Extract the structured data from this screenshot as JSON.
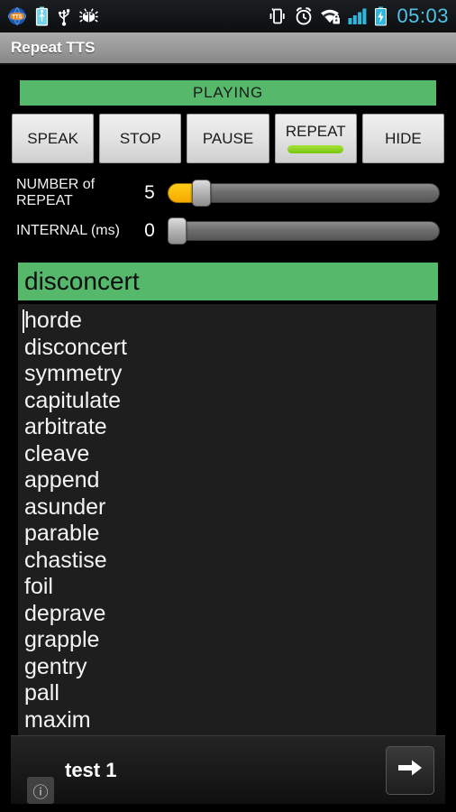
{
  "statusbar": {
    "time": "05:03",
    "left_icons": [
      {
        "name": "tts-notification-icon",
        "glyph": "TTS"
      },
      {
        "name": "battery-usb-icon",
        "glyph": "battery"
      },
      {
        "name": "usb-icon",
        "glyph": "usb"
      },
      {
        "name": "android-debug-bug-icon",
        "glyph": "bug"
      }
    ],
    "right_icons": [
      {
        "name": "vibrate-icon",
        "glyph": "vibrate"
      },
      {
        "name": "alarm-clock-icon",
        "glyph": "alarm"
      },
      {
        "name": "wifi-secured-icon",
        "glyph": "wifi"
      },
      {
        "name": "signal-bars-icon",
        "glyph": "signal"
      },
      {
        "name": "battery-charging-icon",
        "glyph": "charging"
      }
    ],
    "colors": {
      "clock": "#4fc3e8",
      "icon": "#ffffff",
      "accent_blue": "#2fb7dd"
    }
  },
  "actionbar": {
    "title": "Repeat TTS"
  },
  "status_banner": {
    "label": "PLAYING",
    "color": "#55b86a"
  },
  "buttons": [
    {
      "label": "SPEAK",
      "name": "speak-button",
      "active": false
    },
    {
      "label": "STOP",
      "name": "stop-button",
      "active": false
    },
    {
      "label": "PAUSE",
      "name": "pause-button",
      "active": false
    },
    {
      "label": "REPEAT",
      "name": "repeat-button",
      "active": true
    },
    {
      "label": "HIDE",
      "name": "hide-button",
      "active": false
    }
  ],
  "sliders": [
    {
      "name": "number-of-repeat",
      "label": "NUMBER of REPEAT",
      "value": "5",
      "fill_percent": 11,
      "thumb_percent": 11,
      "fill_color": "#f5a800"
    },
    {
      "name": "internal-ms",
      "label": "INTERNAL (ms)",
      "value": "0",
      "fill_percent": 0,
      "thumb_percent": 0,
      "fill_color": "#f5a800"
    }
  ],
  "current_word": {
    "text": "disconcert"
  },
  "word_list": {
    "items": [
      "horde",
      "disconcert",
      "symmetry",
      "capitulate",
      "arbitrate",
      "cleave",
      "append",
      "asunder",
      "parable",
      "chastise",
      "foil",
      "deprave",
      "grapple",
      "gentry",
      "pall",
      "maxim"
    ]
  },
  "ad_banner": {
    "text": "test 1",
    "cta_icon": "arrow-right-icon",
    "info_icon": "info-icon",
    "info_glyph": "ⓘ"
  }
}
